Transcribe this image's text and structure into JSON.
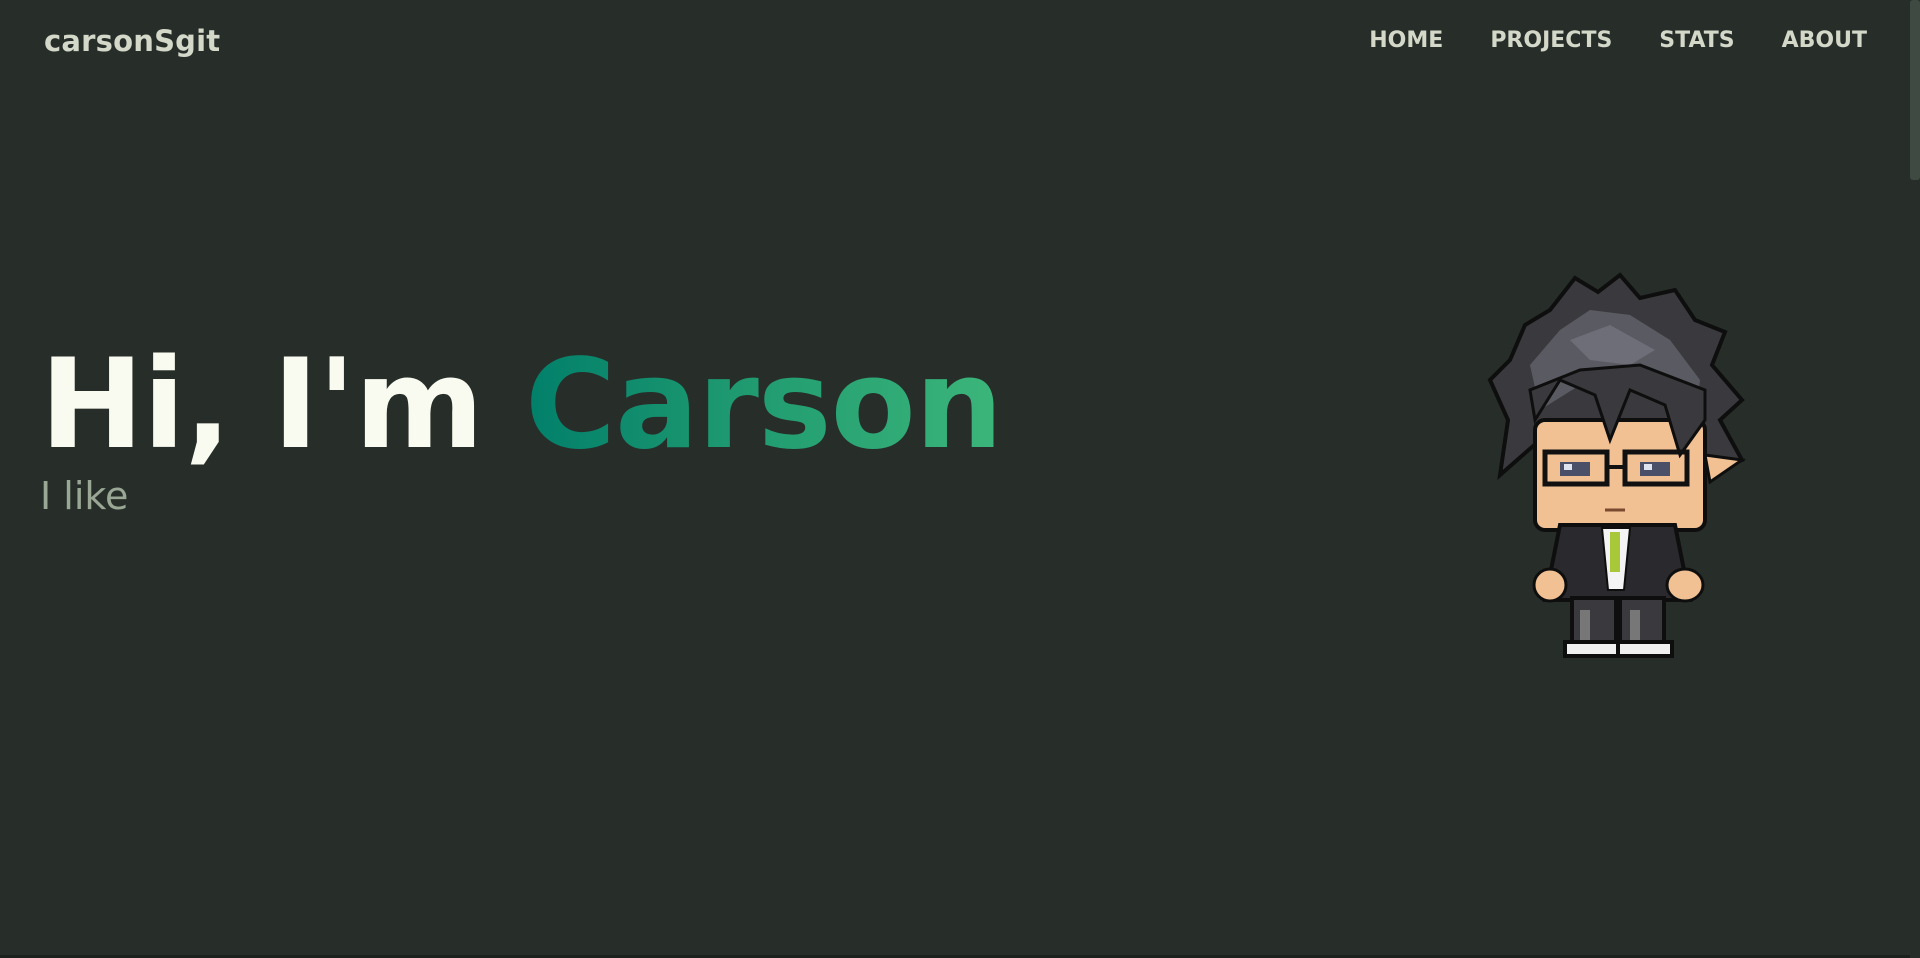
{
  "navbar": {
    "brand": "carsonSgit",
    "links": [
      "HOME",
      "PROJECTS",
      "STATS",
      "ABOUT"
    ]
  },
  "hero": {
    "greeting": "Hi, I'm ",
    "name": "Carson",
    "subtitle": "I like"
  },
  "colors": {
    "background": "#272e2a",
    "text_primary": "#fafbf0",
    "text_nav": "#d4d8c9",
    "subtitle": "#9aa794",
    "gradient_start": "#017f6a",
    "gradient_end": "#3cb67a"
  },
  "avatar": {
    "icon": "pixel-character-avatar"
  }
}
